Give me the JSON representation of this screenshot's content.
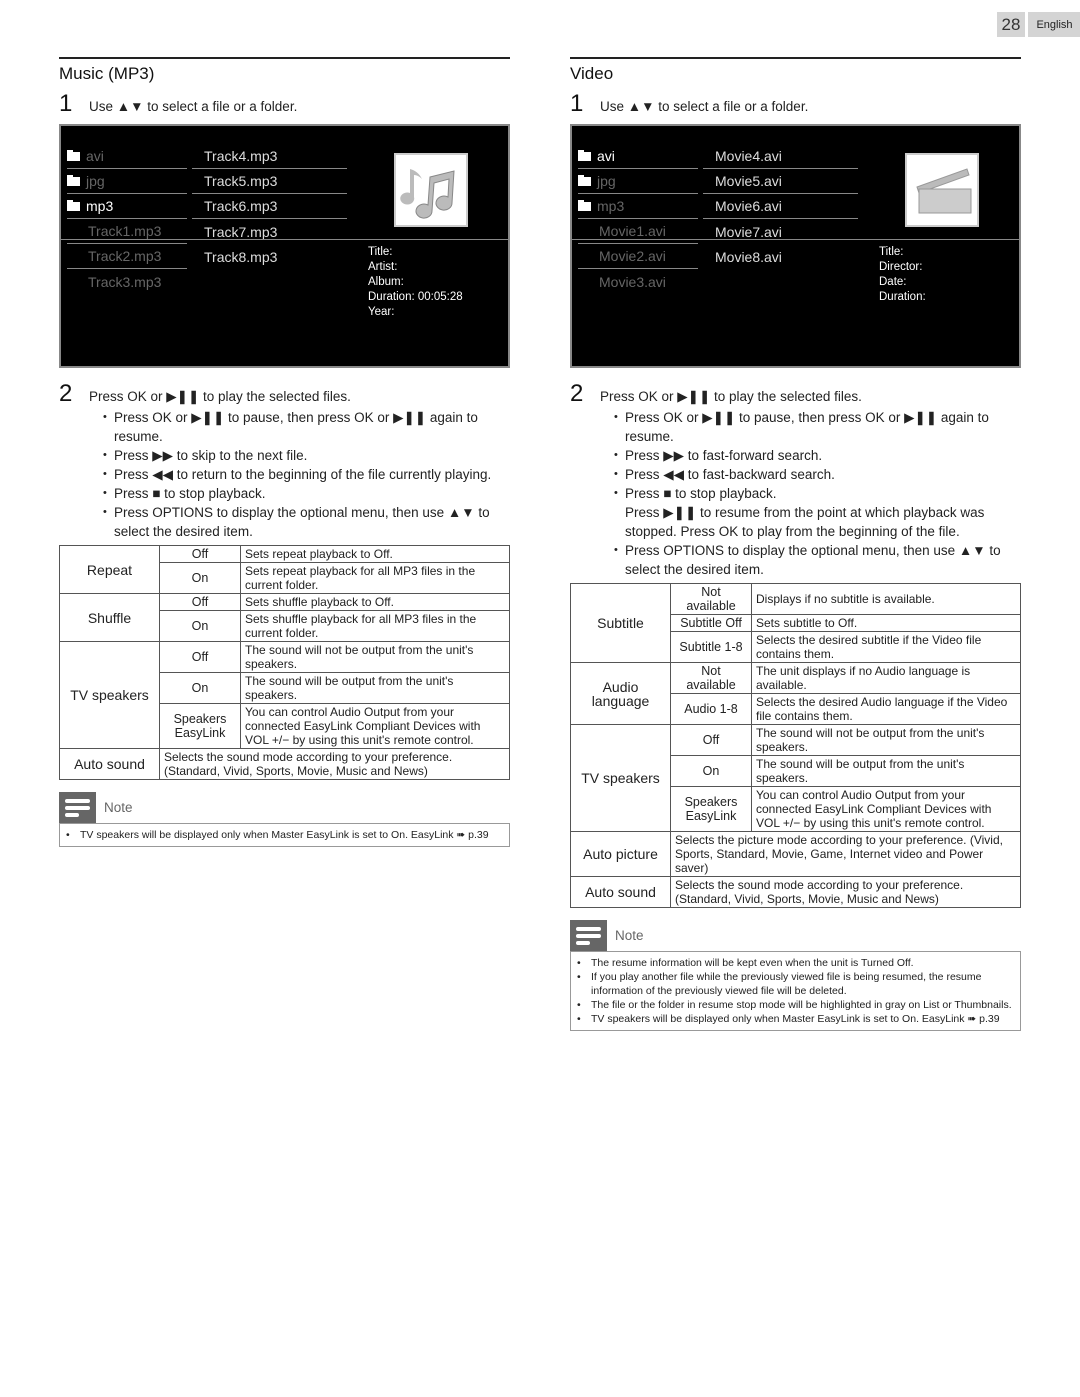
{
  "page": {
    "number": "28",
    "language": "English"
  },
  "music": {
    "title": "Music (MP3)",
    "step1_num": "1",
    "step1_text": "Use ▲▼ to select a file or a folder.",
    "screen": {
      "col1": [
        {
          "label": "avi",
          "folder": true,
          "dim": true
        },
        {
          "label": "jpg",
          "folder": true,
          "dim": true
        },
        {
          "label": "mp3",
          "folder": true,
          "dim": false
        },
        {
          "label": "Track1.mp3",
          "folder": false,
          "dim": true
        },
        {
          "label": "Track2.mp3",
          "folder": false,
          "dim": true
        },
        {
          "label": "Track3.mp3",
          "folder": false,
          "dim": true
        }
      ],
      "col2": [
        "Track4.mp3",
        "Track5.mp3",
        "Track6.mp3",
        "Track7.mp3",
        "Track8.mp3"
      ],
      "thumbnail_icon": "music-note-icon",
      "info": [
        "Title:",
        "Artist:",
        "Album:",
        "Duration: 00:05:28",
        "Year:"
      ]
    },
    "step2_num": "2",
    "step2_text": "Press OK or ▶❚❚ to play the selected files.",
    "bullets": [
      "Press OK or ▶❚❚ to pause, then press OK or ▶❚❚ again to resume.",
      "Press ▶▶ to skip to the next file.",
      "Press ◀◀ to return to the beginning of the file currently playing.",
      "Press ■ to stop playback.",
      "Press OPTIONS to display the optional menu, then use ▲▼ to select the desired item."
    ],
    "table": [
      {
        "item": "Repeat",
        "options": [
          {
            "opt": "Off",
            "desc": "Sets repeat playback to Off."
          },
          {
            "opt": "On",
            "desc": "Sets repeat playback for all MP3 files in the current folder."
          }
        ]
      },
      {
        "item": "Shuffle",
        "options": [
          {
            "opt": "Off",
            "desc": "Sets shuffle playback to Off."
          },
          {
            "opt": "On",
            "desc": "Sets shuffle playback for all MP3 files in the current folder."
          }
        ]
      },
      {
        "item": "TV speakers",
        "options": [
          {
            "opt": "Off",
            "desc": "The sound will not be output from the unit's speakers."
          },
          {
            "opt": "On",
            "desc": "The sound will be output from the unit's speakers."
          },
          {
            "opt": "Speakers EasyLink",
            "desc": "You can control Audio Output from your connected EasyLink Compliant Devices with VOL +/− by using this unit's remote control."
          }
        ]
      },
      {
        "item": "Auto sound",
        "desc": "Selects the sound mode according to your preference. (Standard, Vivid, Sports, Movie, Music and News)"
      }
    ],
    "note_label": "Note",
    "notes": [
      "TV speakers will be displayed only when Master EasyLink is set to On. EasyLink ➠ p.39"
    ]
  },
  "video": {
    "title": "Video",
    "step1_num": "1",
    "step1_text": "Use ▲▼ to select a file or a folder.",
    "screen": {
      "col1": [
        {
          "label": "avi",
          "folder": true,
          "dim": false
        },
        {
          "label": "jpg",
          "folder": true,
          "dim": true
        },
        {
          "label": "mp3",
          "folder": true,
          "dim": true
        },
        {
          "label": "Movie1.avi",
          "folder": false,
          "dim": true
        },
        {
          "label": "Movie2.avi",
          "folder": false,
          "dim": true
        },
        {
          "label": "Movie3.avi",
          "folder": false,
          "dim": true
        }
      ],
      "col2": [
        "Movie4.avi",
        "Movie5.avi",
        "Movie6.avi",
        "Movie7.avi",
        "Movie8.avi"
      ],
      "thumbnail_icon": "clapperboard-icon",
      "info": [
        "Title:",
        "Director:",
        "Date:",
        "Duration:"
      ]
    },
    "step2_num": "2",
    "step2_text": "Press OK or ▶❚❚ to play the selected files.",
    "bullets": [
      {
        "text": "Press OK or ▶❚❚ to pause, then press OK or ▶❚❚ again to resume.",
        "bullet": true
      },
      {
        "text": "Press ▶▶ to fast-forward search.",
        "bullet": true
      },
      {
        "text": "Press ◀◀ to fast-backward search.",
        "bullet": true
      },
      {
        "text": "Press ■ to stop playback.",
        "bullet": true
      },
      {
        "text": "Press ▶❚❚ to resume from the point at which playback was stopped. Press OK to play from the beginning of the file.",
        "bullet": false
      },
      {
        "text": "Press OPTIONS to display the optional menu, then use ▲▼ to select the desired item.",
        "bullet": true
      }
    ],
    "table": [
      {
        "item": "Subtitle",
        "options": [
          {
            "opt": "Not available",
            "desc": "Displays if no subtitle is available."
          },
          {
            "opt": "Subtitle Off",
            "desc": "Sets subtitle to Off."
          },
          {
            "opt": "Subtitle 1-8",
            "desc": "Selects the desired subtitle if the Video file contains them."
          }
        ]
      },
      {
        "item": "Audio language",
        "options": [
          {
            "opt": "Not available",
            "desc": "The unit displays if no Audio language is available."
          },
          {
            "opt": "Audio 1-8",
            "desc": "Selects the desired Audio language if the Video file contains them."
          }
        ]
      },
      {
        "item": "TV speakers",
        "options": [
          {
            "opt": "Off",
            "desc": "The sound will not be output from the unit's speakers."
          },
          {
            "opt": "On",
            "desc": "The sound will be output from the unit's speakers."
          },
          {
            "opt": "Speakers EasyLink",
            "desc": "You can control Audio Output from your connected EasyLink Compliant Devices with VOL +/− by using this unit's remote control."
          }
        ]
      },
      {
        "item": "Auto picture",
        "desc": "Selects the picture mode according to your preference. (Vivid, Sports, Standard, Movie, Game, Internet video and Power saver)"
      },
      {
        "item": "Auto sound",
        "desc": "Selects the sound mode according to your preference. (Standard, Vivid, Sports, Movie, Music and News)"
      }
    ],
    "note_label": "Note",
    "notes": [
      "The resume information will be kept even when the unit is Turned Off.",
      "If you play another file while the previously viewed file is being resumed, the resume information of the previously viewed file will be deleted.",
      "The file or the folder in resume stop mode will be highlighted in gray on List or Thumbnails.",
      "TV speakers will be displayed only when Master EasyLink is set to On. EasyLink ➠ p.39"
    ]
  }
}
